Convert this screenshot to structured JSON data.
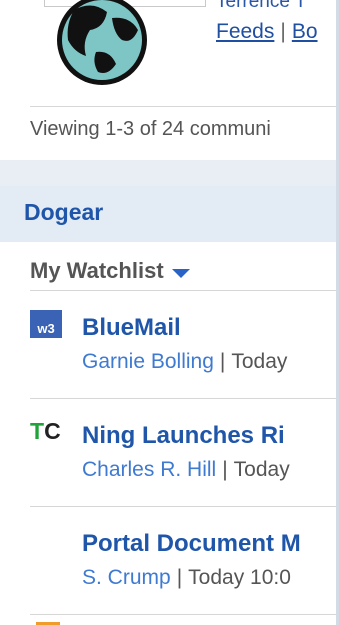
{
  "communities": {
    "name_partial": "Terrence T",
    "links": [
      "Feeds",
      "Bo"
    ],
    "viewing_text": "Viewing 1-3 of 24 communi"
  },
  "dogear": {
    "title": "Dogear",
    "watchlist_label": "My Watchlist",
    "items": [
      {
        "icon": "w3-icon",
        "icon_text": "w3",
        "title": "BlueMail",
        "author": "Garnie Bolling",
        "time": "Today"
      },
      {
        "icon": "tc-icon",
        "icon_text_t": "T",
        "icon_text_c": "C",
        "title": "Ning Launches Ri",
        "author": "Charles R. Hill",
        "time": "Today"
      },
      {
        "icon": "",
        "title": "Portal Document M",
        "author": "S. Crump",
        "time": "Today 10:0"
      }
    ]
  },
  "colors": {
    "link": "#1f56a9",
    "author": "#3f7ad1",
    "header_bg": "#e3ebf5",
    "tc_green": "#1fa33a"
  }
}
